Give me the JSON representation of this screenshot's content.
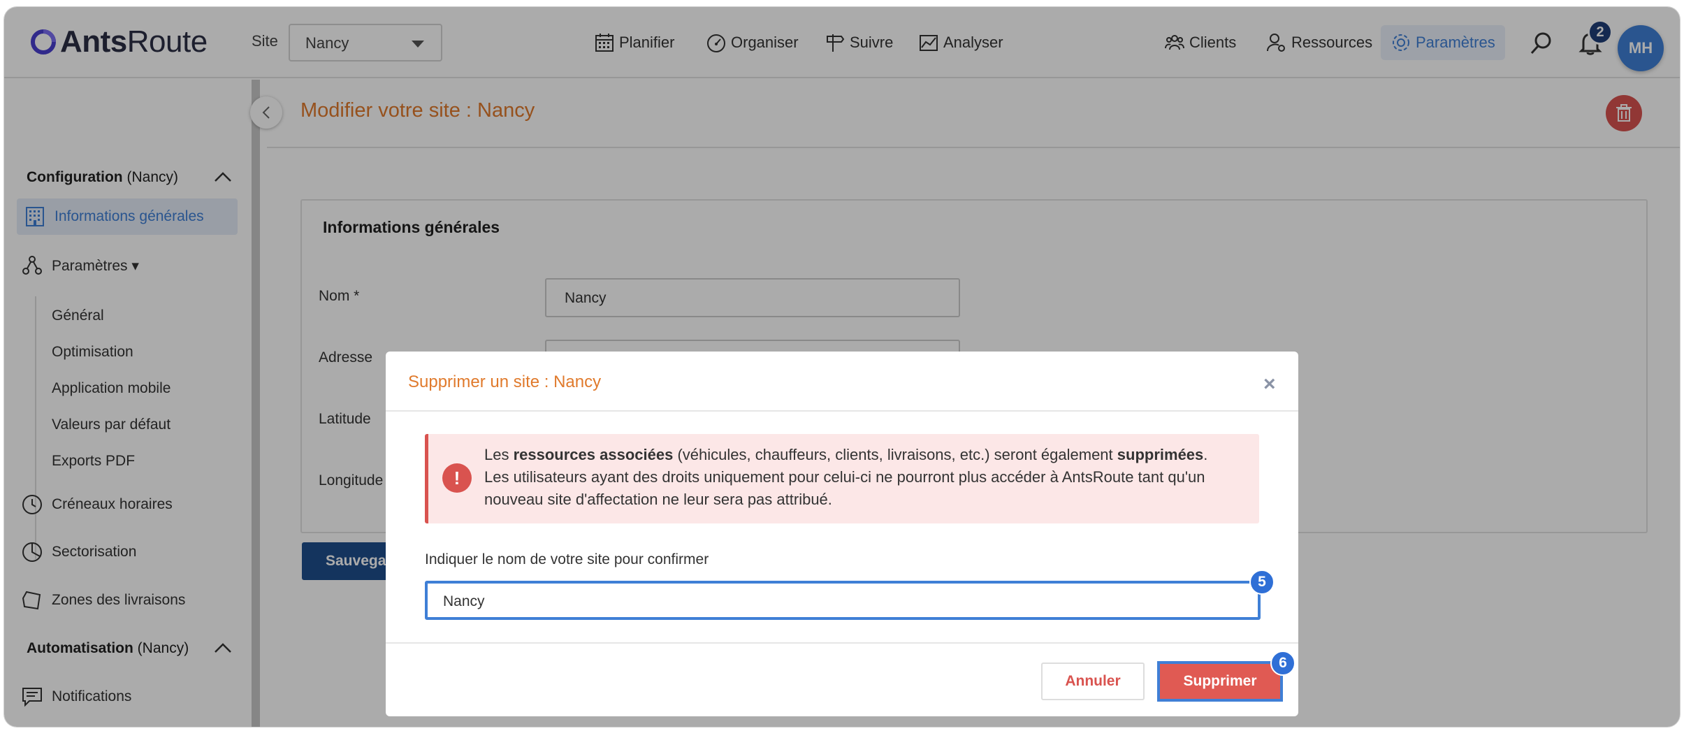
{
  "header": {
    "logo_bold": "Ants",
    "logo_light": "Route",
    "site_label": "Site",
    "site_value": "Nancy",
    "nav": [
      {
        "label": "Planifier",
        "icon": "calendar-icon"
      },
      {
        "label": "Organiser",
        "icon": "speedometer-icon"
      },
      {
        "label": "Suivre",
        "icon": "signpost-icon"
      },
      {
        "label": "Analyser",
        "icon": "chart-icon"
      }
    ],
    "right_nav": [
      {
        "label": "Clients",
        "icon": "clients-icon"
      },
      {
        "label": "Ressources",
        "icon": "resources-icon"
      },
      {
        "label": "Paramètres",
        "icon": "gear-icon",
        "active": true
      }
    ],
    "notification_count": "2",
    "avatar_initials": "MH",
    "accent": "#3f7fd6"
  },
  "sidebar": {
    "config_head_bold": "Configuration",
    "config_head_site": " (Nancy)",
    "items": [
      {
        "label": "Informations générales"
      },
      {
        "label": "Paramètres ▾"
      },
      {
        "label": "Créneaux horaires"
      },
      {
        "label": "Sectorisation"
      },
      {
        "label": "Zones des livraisons"
      },
      {
        "label": "Notifications"
      }
    ],
    "sub_items": [
      "Général",
      "Optimisation",
      "Application mobile",
      "Valeurs par défaut",
      "Exports PDF"
    ],
    "auto_head_bold": "Automatisation",
    "auto_head_site": " (Nancy)"
  },
  "main": {
    "title": "Modifier votre site : Nancy",
    "card_title": "Informations générales",
    "fields": [
      {
        "label": "Nom *",
        "value": "Nancy"
      },
      {
        "label": "Adresse"
      },
      {
        "label": "Latitude"
      },
      {
        "label": "Longitude"
      }
    ],
    "save_label": "Sauvegarder"
  },
  "modal": {
    "title": "Supprimer un site : Nancy",
    "close": "×",
    "alert_icon": "!",
    "alert": {
      "p1": "Les ",
      "b1": "ressources associées",
      "p2": " (véhicules, chauffeurs, clients, livraisons, etc.) seront également ",
      "b2": "supprimées",
      "p3": ".",
      "line2": "Les utilisateurs ayant des droits uniquement pour celui-ci ne pourront plus accéder à AntsRoute tant qu'un nouveau site d'affectation ne leur sera pas attribué."
    },
    "confirm_label": "Indiquer le nom de votre site pour confirmer",
    "confirm_value": "Nancy",
    "cancel_label": "Annuler",
    "delete_label": "Supprimer",
    "step_input": "5",
    "step_delete": "6"
  }
}
